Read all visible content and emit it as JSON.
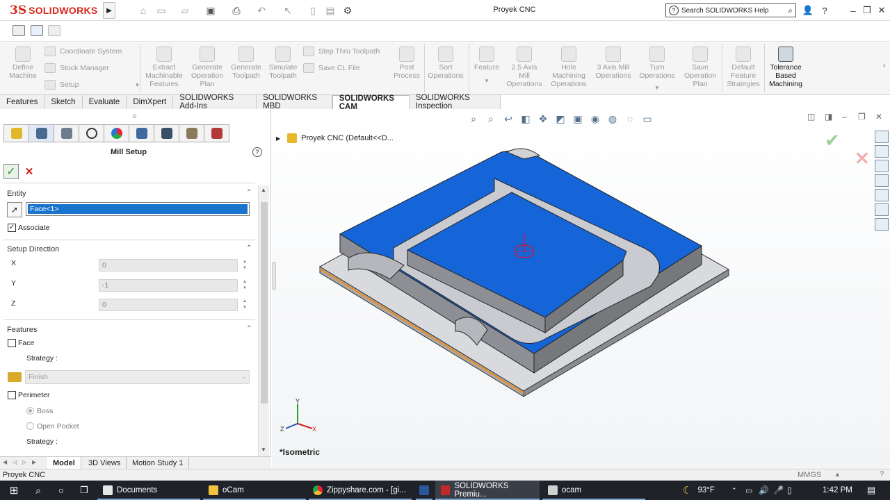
{
  "app": {
    "logo_ds": "3S",
    "logo_brand": "SOLIDWORKS",
    "document_title": "Proyek CNC",
    "search_placeholder": "Search SOLIDWORKS Help"
  },
  "command_manager": {
    "define_machine": "Define\nMachine",
    "coordinate_system": "Coordinate System",
    "stock_manager": "Stock Manager",
    "setup": "Setup",
    "extract_features": "Extract\nMachinable\nFeatures",
    "generate_plan": "Generate\nOperation\nPlan",
    "generate_toolpath": "Generate\nToolpath",
    "simulate_toolpath": "Simulate\nToolpath",
    "step_thru_toolpath": "Step Thru Toolpath",
    "save_cl_file": "Save CL File",
    "post_process": "Post\nProcess",
    "sort_operations": "Sort\nOperations",
    "feature": "Feature",
    "mill_2_5": "2.5 Axis\nMill\nOperations",
    "hole_machining": "Hole\nMachining\nOperations",
    "mill_3_axis": "3 Axis Mill\nOperations",
    "turn_operations": "Turn\nOperations",
    "save_operation_plan": "Save\nOperation\nPlan",
    "default_feature_strategies": "Default\nFeature\nStrategies",
    "tolerance_based_machining": "Tolerance\nBased\nMachining"
  },
  "tabs": [
    "Features",
    "Sketch",
    "Evaluate",
    "DimXpert",
    "SOLIDWORKS Add-Ins",
    "SOLIDWORKS MBD",
    "SOLIDWORKS CAM",
    "SOLIDWORKS Inspection"
  ],
  "property_manager": {
    "title": "Mill Setup",
    "help": "?",
    "entity_section": "Entity",
    "entity_value": "Face<1>",
    "associate_label": "Associate",
    "setup_direction_section": "Setup Direction",
    "x_label": "X",
    "x_value": "0",
    "y_label": "Y",
    "y_value": "-1",
    "z_label": "Z",
    "z_value": "0",
    "features_section": "Features",
    "face_label": "Face",
    "strategy_label": "Strategy :",
    "strategy_value": "Finish",
    "perimeter_label": "Perimeter",
    "boss_label": "Boss",
    "open_pocket_label": "Open Pocket",
    "strategy_label_2": "Strategy :"
  },
  "bottom_tabs": [
    "Model",
    "3D Views",
    "Motion Study 1"
  ],
  "graphics": {
    "tree_item": "Proyek CNC  (Default<<D...",
    "view_name": "*Isometric",
    "axis_x": "X",
    "axis_y": "Y",
    "axis_z": "Z"
  },
  "status_bar": {
    "document": "Proyek CNC",
    "units": "MMGS"
  },
  "taskbar": {
    "documents": "Documents",
    "ocam_folder": "oCam",
    "chrome": "Zippyshare.com - [gi...",
    "solidworks": "SOLIDWORKS Premiu...",
    "ocam_app": "ocam",
    "weather": "93°F",
    "time": "1:42 PM"
  },
  "colors": {
    "brand_red": "#d9261c",
    "face_blue": "#1565d8",
    "selection_blue": "#1874cd",
    "taskbar_bg": "#1f2228"
  }
}
